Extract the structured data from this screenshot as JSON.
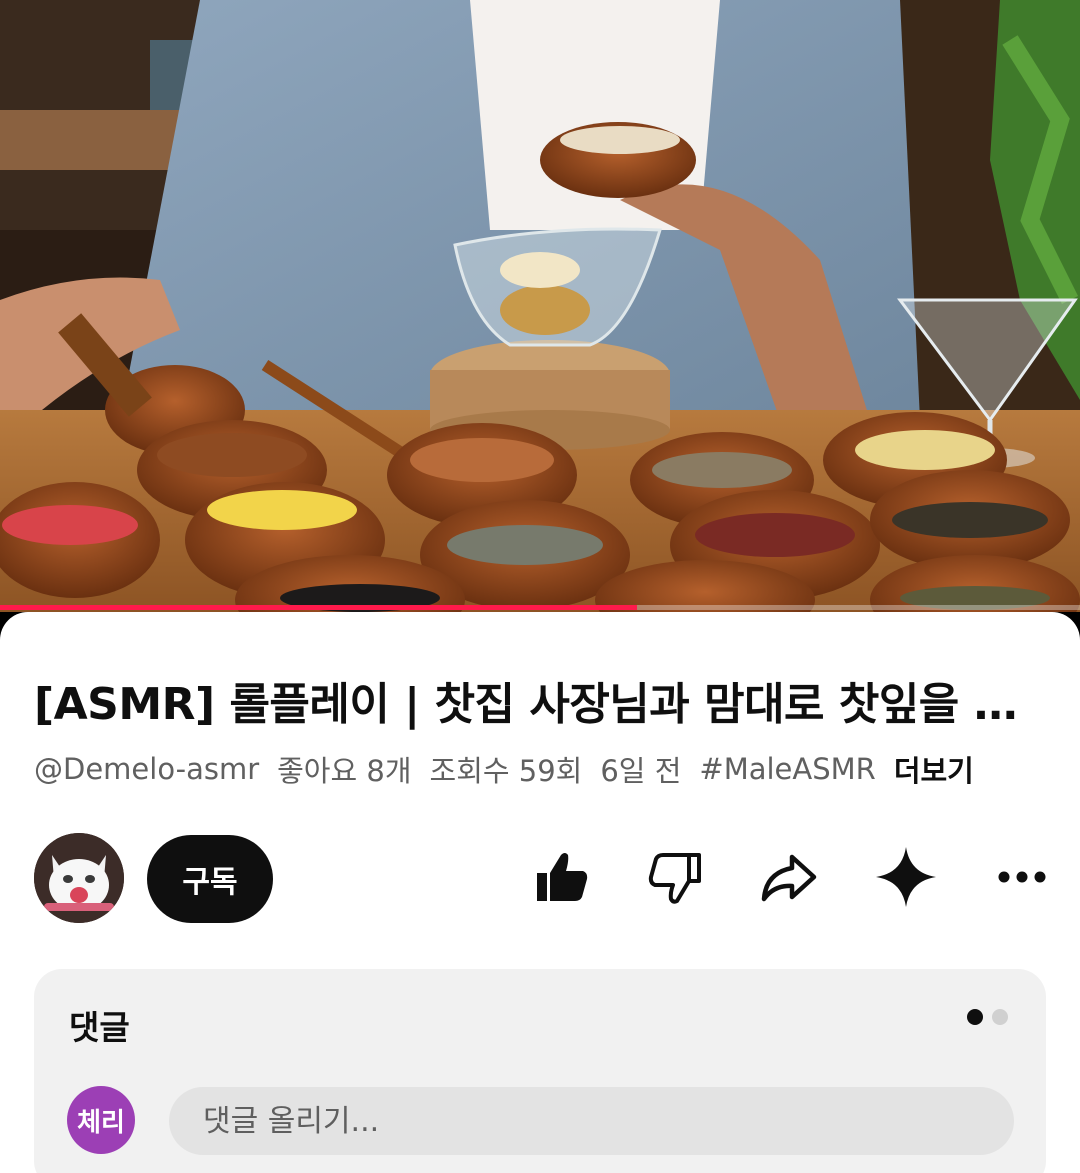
{
  "video": {
    "progress_fraction": 0.59
  },
  "title": "[ASMR] 롤플레이 | 찻집 사장님과 맘대로 찻잎을 섞어보는 카페",
  "meta": {
    "channel": "@Demelo-asmr",
    "likes": "좋아요 8개",
    "views": "조회수 59회",
    "age": "6일 전",
    "hashtag": "#MaleASMR",
    "more_label": "더보기"
  },
  "channel_row": {
    "subscribe_label": "구독"
  },
  "actions": [
    {
      "name": "like-icon"
    },
    {
      "name": "dislike-icon"
    },
    {
      "name": "share-icon"
    },
    {
      "name": "sparkle-icon"
    },
    {
      "name": "more-icon"
    }
  ],
  "comments": {
    "heading": "댓글",
    "user_initials": "체리",
    "input_placeholder": "댓글 올리기..."
  },
  "colors": {
    "progress": "#ff1a4b",
    "user_avatar": "#9c3fb5"
  }
}
